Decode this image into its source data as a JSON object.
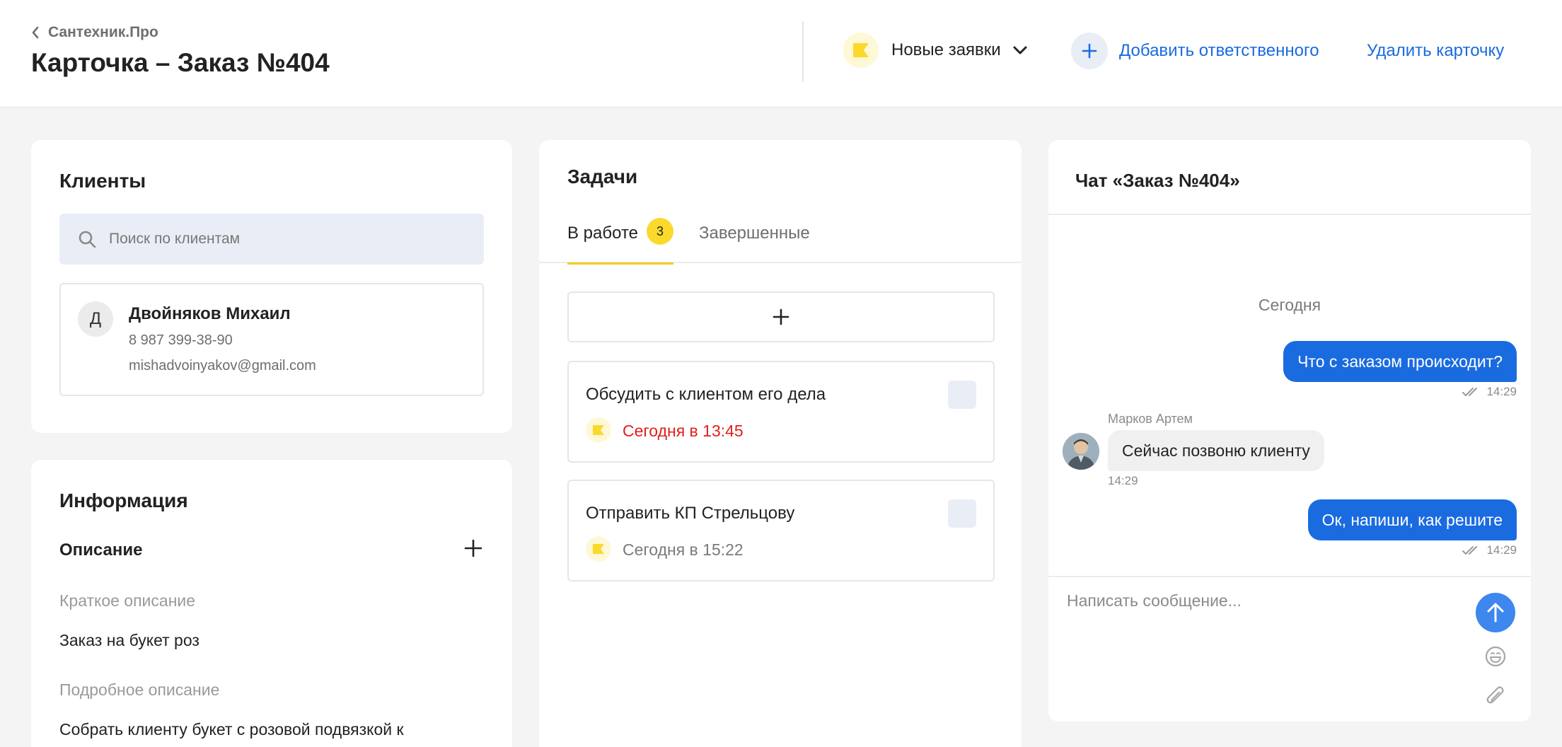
{
  "header": {
    "breadcrumb": "Сантехник.Про",
    "title": "Карточка – Заказ №404",
    "status": "Новые заявки",
    "add_responsible": "Добавить ответственного",
    "delete_card": "Удалить карточку"
  },
  "clients": {
    "title": "Клиенты",
    "search_placeholder": "Поиск по клиентам",
    "items": [
      {
        "initial": "Д",
        "name": "Двойняков Михаил",
        "phone": "8 987 399-38-90",
        "email": "mishadvoinyakov@gmail.com"
      }
    ]
  },
  "info": {
    "title": "Информация",
    "description_heading": "Описание",
    "short_label": "Краткое описание",
    "short_value": "Заказ на букет роз",
    "long_label": "Подробное описание",
    "long_value": "Собрать клиенту букет с розовой подвязкой к"
  },
  "tasks": {
    "title": "Задачи",
    "tabs": [
      {
        "label": "В работе",
        "count": "3",
        "active": true
      },
      {
        "label": "Завершенные",
        "active": false
      }
    ],
    "items": [
      {
        "title": "Обсудить с клиентом его дела",
        "due": "Сегодня в 13:45",
        "overdue": true
      },
      {
        "title": "Отправить КП Стрельцову",
        "due": "Сегодня в 15:22",
        "overdue": false
      }
    ]
  },
  "chat": {
    "title": "Чат «Заказ №404»",
    "date_divider": "Сегодня",
    "messages": [
      {
        "direction": "out",
        "text": "Что с заказом происходит?",
        "time": "14:29"
      },
      {
        "direction": "in",
        "sender": "Марков Артем",
        "text": "Сейчас позвоню клиенту",
        "time": "14:29"
      },
      {
        "direction": "out",
        "text": "Ок, напиши, как решите",
        "time": "14:29"
      }
    ],
    "input_placeholder": "Написать сообщение..."
  },
  "colors": {
    "accent_blue": "#1a6be0",
    "flag_yellow": "#fbd92c",
    "overdue_red": "#e0201c"
  }
}
